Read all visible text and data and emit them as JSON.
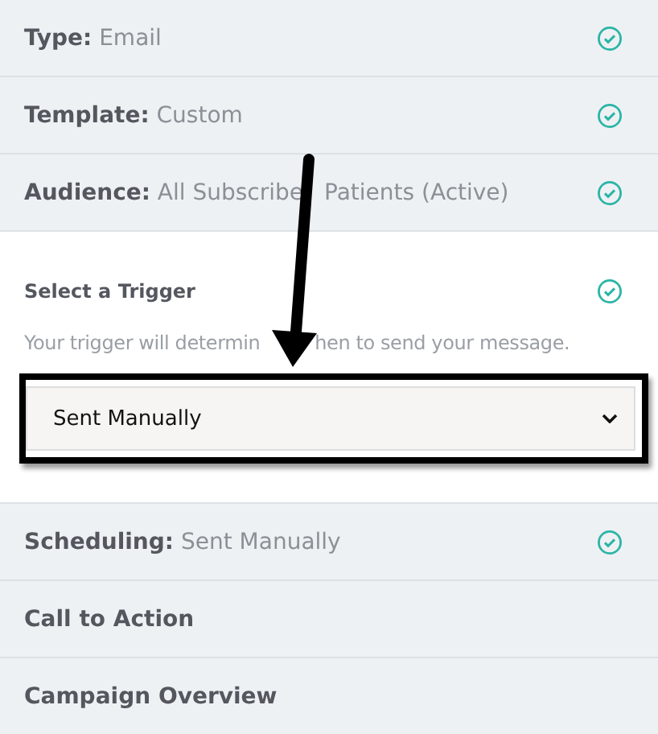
{
  "steps": [
    {
      "kind": "summary",
      "label": "Type:",
      "value": "Email",
      "completed": true
    },
    {
      "kind": "summary",
      "label": "Template:",
      "value": "Custom",
      "completed": true
    },
    {
      "kind": "summary",
      "label": "Audience:",
      "value": "All Subscribe",
      "value_after_arrow": "Patients (Active)",
      "completed": true
    },
    {
      "kind": "open",
      "title": "Select a Trigger",
      "description": "Your trigger will determin",
      "description_after_arrow": "hen to send your message.",
      "select": {
        "value": "Sent Manually"
      },
      "completed": true
    },
    {
      "kind": "summary",
      "label": "Scheduling:",
      "value": "Sent Manually",
      "completed": true
    },
    {
      "kind": "summary",
      "label": "Call to Action",
      "completed": false
    },
    {
      "kind": "summary",
      "label": "Campaign Overview",
      "completed": false
    }
  ]
}
